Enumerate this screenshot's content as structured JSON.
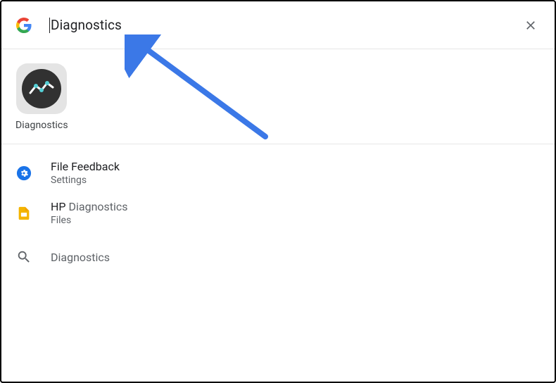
{
  "search": {
    "query": "Diagnostics"
  },
  "app_result": {
    "label": "Diagnostics"
  },
  "results": [
    {
      "title": "File Feedback",
      "subtitle": "Settings"
    },
    {
      "title_prefix": "HP ",
      "title_match": "Diagnostics",
      "subtitle": "Files"
    },
    {
      "search_label": "Diagnostics"
    }
  ]
}
